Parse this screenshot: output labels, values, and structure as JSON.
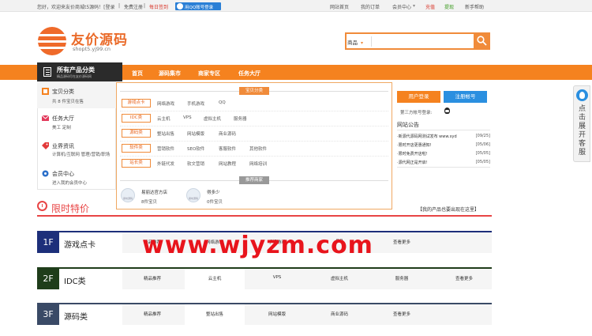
{
  "topbar": {
    "welcome": "您好，欢迎来友价商城t5源码！[登录",
    "sep1": "|",
    "register": "免费注册",
    "sep2": "|",
    "checkin": "每日签到",
    "qq_login": "用QQ账号登录",
    "links": [
      "网站首页",
      "我的订单",
      "会员中心",
      "充值",
      "提现",
      "新手帮助"
    ]
  },
  "logo": {
    "name": "友价源码",
    "sub": "shopt5.yj99.cn"
  },
  "search": {
    "type": "商品",
    "placeholder": ""
  },
  "nav": {
    "all_title": "所有产品分类",
    "all_sub": "精品源码尽在友价源码网",
    "items": [
      "首页",
      "源码集市",
      "商家专区",
      "任务大厅"
    ]
  },
  "sidebar": {
    "sections": [
      {
        "title": "宝贝分类",
        "sub": "共 8 件宝贝在售",
        "icon": "grid-icon"
      },
      {
        "title": "任务大厅",
        "sub": "美工  定制",
        "icon": "mail-icon"
      },
      {
        "title": "业界资讯",
        "sub": "计算机/互联网 管理/营销/职场",
        "icon": "tag-icon"
      },
      {
        "title": "会员中心",
        "sub": "进入我的会员中心",
        "icon": "gear-icon"
      }
    ]
  },
  "panel": {
    "title": "宝贝分类",
    "rows": [
      {
        "cat": "游戏点卡",
        "items": [
          "网络游戏",
          "手机游戏",
          "QQ"
        ]
      },
      {
        "cat": "IDC类",
        "items": [
          "云主机",
          "VPS",
          "虚拟主机",
          "服务器"
        ]
      },
      {
        "cat": "源码类",
        "items": [
          "整站出售",
          "网站模版",
          "商业源码"
        ]
      },
      {
        "cat": "软件类",
        "items": [
          "营销软件",
          "SEO软件",
          "客服软件",
          "其他软件"
        ]
      },
      {
        "cat": "站长类",
        "items": [
          "外链代发",
          "软文营销",
          "网站教程",
          "网络培训"
        ]
      }
    ],
    "shops_title": "推荐商家",
    "shops": [
      {
        "name": "易丽达官方店",
        "count": "8件宝贝",
        "icon_text": "易坊源码"
      },
      {
        "name": "得多少",
        "count": "0件宝贝",
        "icon_text": "易坊源码"
      }
    ]
  },
  "right": {
    "login": "用户登录",
    "register": "注册帐号",
    "third": "第三方帐号登录:",
    "news_title": "网站公告",
    "news": [
      {
        "text": "·新源代源码网测试发布 www.xyd",
        "date": "[09/25]"
      },
      {
        "text": "·限时开店更惠通知!",
        "date": "[05/06]"
      },
      {
        "text": "·限时免费开店啦!",
        "date": "[05/05]"
      },
      {
        "text": "·源代网正是开启!",
        "date": "[05/05]"
      }
    ]
  },
  "service": {
    "text": "点击展开客服"
  },
  "limited": {
    "title": "限时特价",
    "link": "【我的产品也要出现在这里】"
  },
  "floors": [
    {
      "num": "1F",
      "name": "游戏点卡",
      "color": "#1d2f7a",
      "tabs": [
        "精品推荐",
        "网络游戏",
        "手机游戏",
        "QQ",
        "查看更多"
      ],
      "active": -1
    },
    {
      "num": "2F",
      "name": "IDC类",
      "color": "#1f3d1a",
      "tabs": [
        "精品推荐",
        "云主机",
        "VPS",
        "虚拟主机",
        "服务器",
        "查看更多"
      ],
      "active": 1
    },
    {
      "num": "3F",
      "name": "源码类",
      "color": "#3a4a66",
      "tabs": [
        "精品推荐",
        "整站出售",
        "网站模版",
        "商业源码",
        "查看更多"
      ],
      "active": 1
    }
  ],
  "watermark": "www.wjyzm.com",
  "colors": {
    "accent": "#f5821f",
    "dark": "#2b2b2b",
    "red": "#e84545",
    "blue": "#2a8fe0"
  }
}
